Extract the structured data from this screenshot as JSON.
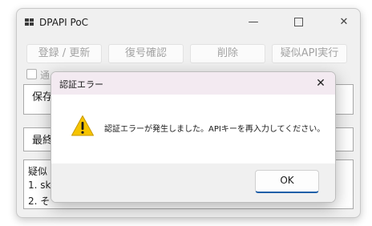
{
  "window": {
    "title": "DPAPI PoC"
  },
  "title_buttons": {
    "minimize": "—",
    "close": "✕"
  },
  "toolbar": {
    "register_label": "登録 / 更新",
    "check_label": "復号確認",
    "delete_label": "削除",
    "api_label": "疑似API実行"
  },
  "checkbox": {
    "label": "通",
    "checked": false
  },
  "panels": {
    "saved": "保存",
    "last": "最終"
  },
  "log": {
    "line1": "疑似",
    "line2": "1. sk",
    "line3": "2. そ"
  },
  "dialog": {
    "title": "認証エラー",
    "close": "✕",
    "message": "認証エラーが発生しました。APIキーを再入力してください。",
    "ok_label": "OK",
    "icon": "warning-icon"
  },
  "colors": {
    "warning": "#f6c400",
    "dialog_title_bg": "#f3eaf1",
    "accent": "#1f5fa8"
  }
}
